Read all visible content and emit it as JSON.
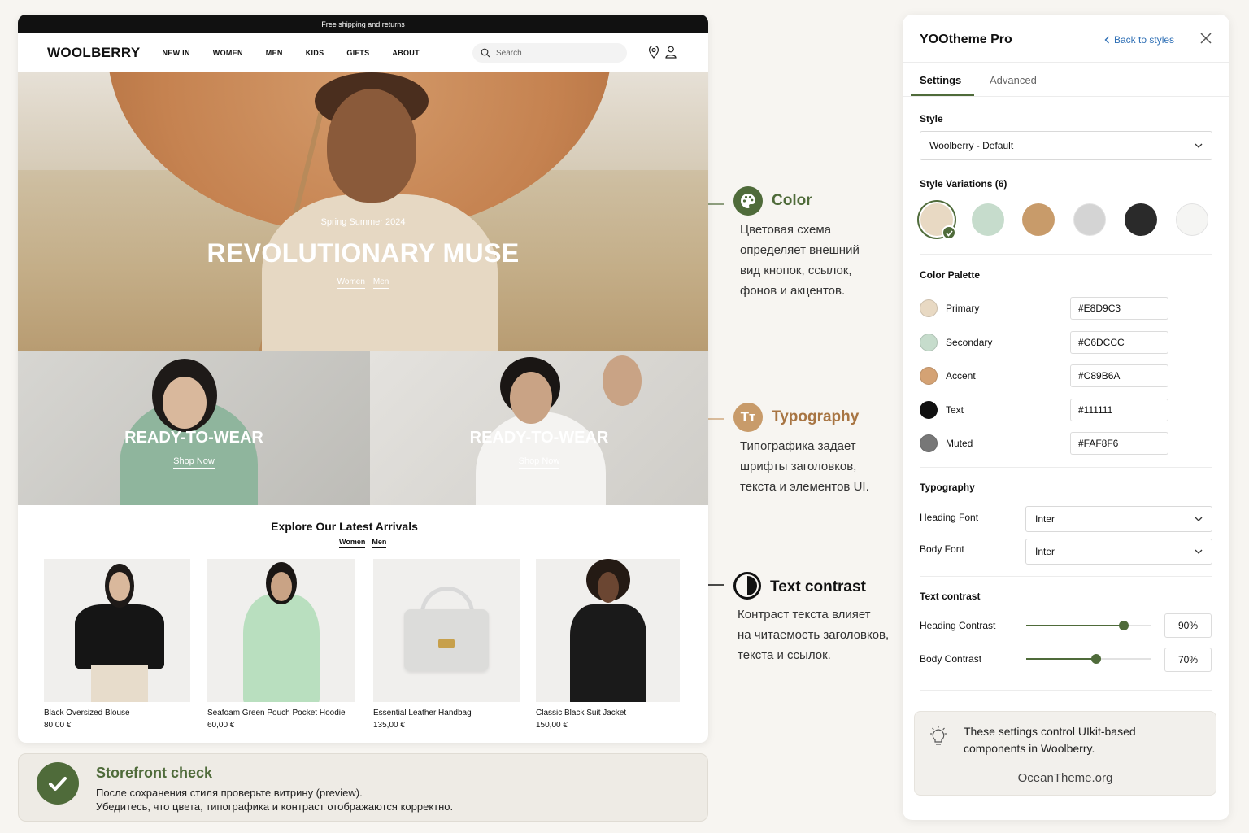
{
  "store": {
    "topbar": "Free shipping and returns",
    "logo": "WOOLBERRY",
    "nav": [
      "NEW IN",
      "WOMEN",
      "MEN",
      "KIDS",
      "GIFTS",
      "ABOUT"
    ],
    "search_placeholder": "Search",
    "hero": {
      "kicker": "Spring Summer 2024",
      "title": "REVOLUTIONARY MUSE",
      "link_women": "Women",
      "link_men": "Men"
    },
    "categories": [
      {
        "title": "READY-TO-WEAR",
        "link": "Shop Now"
      },
      {
        "title": "READY-TO-WEAR",
        "link": "Shop Now"
      }
    ],
    "arrivals": {
      "title": "Explore Our Latest Arrivals",
      "tab_women": "Women",
      "tab_men": "Men",
      "products": [
        {
          "name": "Black Oversized Blouse",
          "price": "80,00 €"
        },
        {
          "name": "Seafoam Green Pouch Pocket Hoodie",
          "price": "60,00 €"
        },
        {
          "name": "Essential Leather Handbag",
          "price": "135,00 €"
        },
        {
          "name": "Classic Black Suit Jacket",
          "price": "150,00 €"
        }
      ]
    }
  },
  "check": {
    "title": "Storefront check",
    "line1": "После сохранения стиля проверьте витрину (preview).",
    "line2": "Убедитесь, что цвета, типографика и контраст отображаются корректно."
  },
  "callouts": {
    "color": {
      "title": "Color",
      "lines": [
        "Цветовая схема",
        "определяет внешний",
        "вид кнопок, ссылок,",
        "фонов и акцентов."
      ]
    },
    "typography": {
      "title": "Typography",
      "icon_text": "Tт",
      "lines": [
        "Типографика задает",
        "шрифты заголовков,",
        "текста и элементов UI."
      ]
    },
    "contrast": {
      "title": "Text contrast",
      "lines": [
        "Контраст текста влияет",
        "на читаемость заголовков,",
        "текста и ссылок."
      ]
    }
  },
  "panel": {
    "title": "YOOtheme Pro",
    "back_link": "Back to styles",
    "tab_settings": "Settings",
    "tab_advanced": "Advanced",
    "style_label": "Style",
    "style_value": "Woolberry - Default",
    "variations_label": "Style Variations (6)",
    "variation_colors": [
      "#E8D9C3",
      "#C6DCCC",
      "#C89B6A",
      "#D4D4D4",
      "#2A2A2A",
      "#F5F5F3"
    ],
    "palette_label": "Color Palette",
    "palette": [
      {
        "name": "Primary",
        "hex": "#E8D9C3",
        "swatch": "#E8D9C3"
      },
      {
        "name": "Secondary",
        "hex": "#C6DCCC",
        "swatch": "#C6DCCC"
      },
      {
        "name": "Accent",
        "hex": "#C89B6A",
        "swatch": "#D4A274"
      },
      {
        "name": "Text",
        "hex": "#111111",
        "swatch": "#111111"
      },
      {
        "name": "Muted",
        "hex": "#FAF8F6",
        "swatch": "#777777"
      }
    ],
    "typography_label": "Typography",
    "heading_font_label": "Heading Font",
    "heading_font": "Inter",
    "body_font_label": "Body Font",
    "body_font": "Inter",
    "contrast_label": "Text contrast",
    "heading_contrast_label": "Heading Contrast",
    "heading_contrast": "90%",
    "heading_contrast_value": 0.78,
    "body_contrast_label": "Body Contrast",
    "body_contrast": "70%",
    "body_contrast_value": 0.56,
    "note_line1": "These settings control UIkit-based",
    "note_line2": "components in Woolberry.",
    "note_site": "OceanTheme.org"
  },
  "colors": {
    "brand_green": "#4F6B3A",
    "typography_accent": "#C89B6A",
    "link_blue": "#2E6FB5"
  }
}
